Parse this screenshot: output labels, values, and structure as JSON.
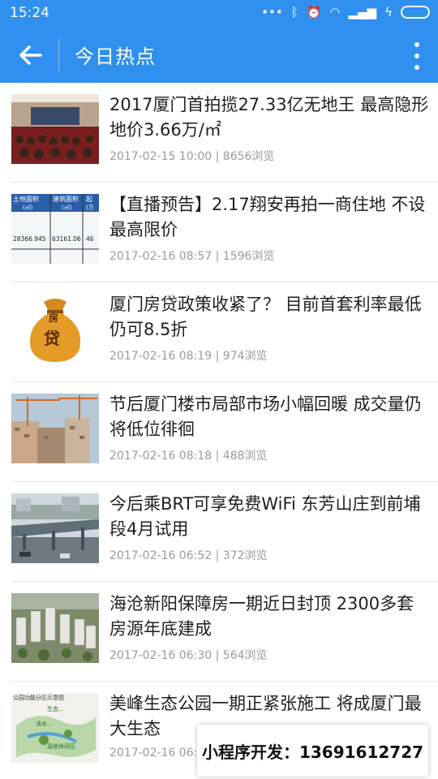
{
  "status": {
    "time": "15:24",
    "icons": [
      "more-dots-icon",
      "bluetooth-icon",
      "alarm-icon",
      "wifi-icon",
      "signal-icon",
      "charging-icon",
      "battery-icon"
    ]
  },
  "header": {
    "title": "今日热点",
    "icons": [
      "back-arrow-icon",
      "overflow-menu-icon"
    ]
  },
  "colors": {
    "primary": "#2f90ef",
    "text": "#1f1f1f",
    "meta": "#9a9a9a"
  },
  "articles": [
    {
      "title": "2017厦门首拍揽27.33亿无地王 最高隐形地价3.66万/㎡",
      "date": "2017-02-15 10:00",
      "views": "8656浏览"
    },
    {
      "title": "【直播预告】2.17翔安再拍一商住地 不设最高限价",
      "date": "2017-02-16 08:57",
      "views": "1596浏览",
      "thumb_text": [
        "土地面积",
        "建筑面积",
        "起",
        "(㎡)",
        "(㎡)",
        "(万",
        "28366.945",
        "63161.06",
        "46"
      ]
    },
    {
      "title": "厦门房贷政策收紧了？ 目前首套利率最低仍可8.5折",
      "date": "2017-02-16 08:19",
      "views": "974浏览",
      "thumb_text": [
        "房",
        "贷"
      ]
    },
    {
      "title": "节后厦门楼市局部市场小幅回暖 成交量仍将低位徘徊",
      "date": "2017-02-16 08:18",
      "views": "488浏览"
    },
    {
      "title": "今后乘BRT可享免费WiFi 东芳山庄到前埔段4月试用",
      "date": "2017-02-16 06:52",
      "views": "372浏览"
    },
    {
      "title": "海沧新阳保障房一期近日封顶 2300多套房源年底建成",
      "date": "2017-02-16 06:30",
      "views": "564浏览"
    },
    {
      "title": "美峰生态公园一期正紧张施工 将成厦门最大生态",
      "date": "2017-02-16 06:2",
      "views": "",
      "thumb_text": [
        "公园功能分区示意图",
        "生态...",
        "滨水...",
        "湿地休闲区"
      ]
    }
  ],
  "overlay": {
    "text": "小程序开发：13691612727"
  }
}
